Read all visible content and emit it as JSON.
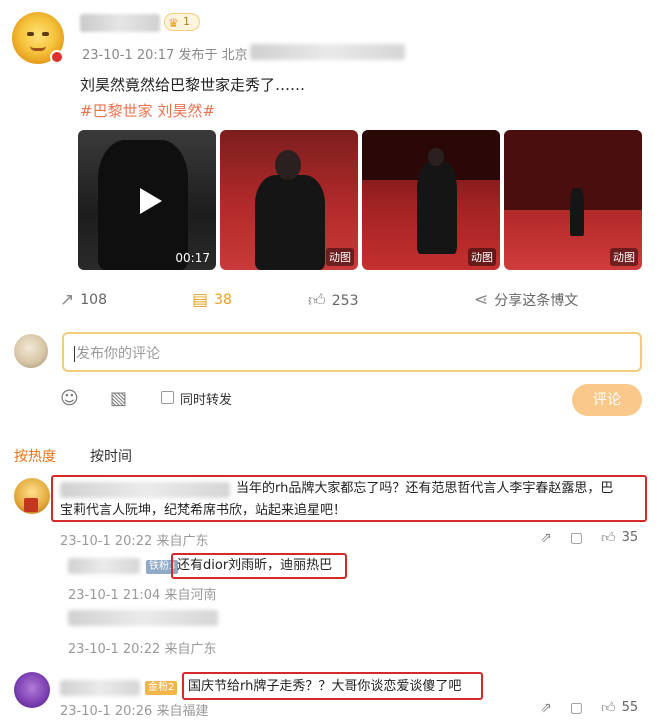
{
  "post": {
    "crown_label": "1",
    "meta": "23-10-1 20:17 发布于 北京",
    "text": "刘昊然竟然给巴黎世家走秀了……",
    "tags": "#巴黎世家 刘昊然#",
    "media": [
      {
        "overlay": "00:17"
      },
      {
        "overlay": "动图"
      },
      {
        "overlay": "动图"
      },
      {
        "overlay": "动图"
      }
    ],
    "actions": {
      "repost": "108",
      "comment": "38",
      "like": "253",
      "share": "分享这条博文"
    }
  },
  "composer": {
    "placeholder": "发布你的评论",
    "repost_label": "同时转发",
    "submit_label": "评论"
  },
  "sort_tabs": {
    "hot": "按热度",
    "time": "按时间"
  },
  "comments": [
    {
      "text_line1": "当年的rh品牌大家都忘了吗？还有范思哲代言人李宇春赵露思，巴",
      "text_line2": "宝莉代言人阮坤，纪梵希席书欣，站起来追星吧！",
      "meta": "23-10-1 20:22 来自广东",
      "likes": "35"
    },
    {
      "badge": "铁粉3",
      "text": "还有dior刘雨昕，迪丽热巴",
      "meta": "23-10-1 21:04 来自河南"
    },
    {
      "meta": "23-10-1 20:22 来自广东"
    },
    {
      "badge": "金粉2",
      "text": "国庆节给rh牌子走秀？？大哥你谈恋爱谈傻了吧",
      "meta": "23-10-1 20:26 来自福建",
      "likes": "55"
    }
  ],
  "colors": {
    "accent": "#e8741c",
    "tag": "#eb7350",
    "highlight_box": "#d42a2a"
  }
}
